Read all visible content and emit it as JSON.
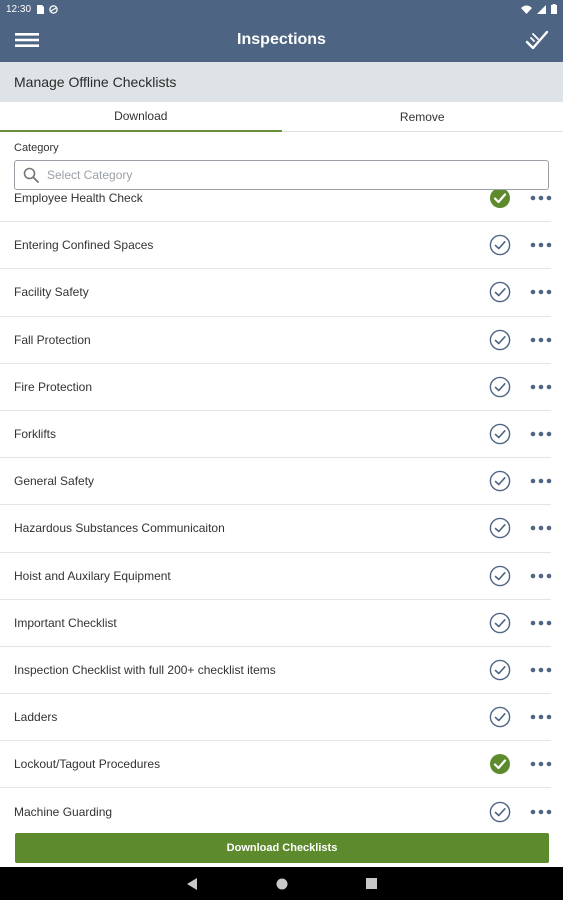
{
  "status_bar": {
    "time": "12:30"
  },
  "app_bar": {
    "title": "Inspections"
  },
  "subheader": {
    "title": "Manage Offline Checklists"
  },
  "tabs": [
    {
      "label": "Download",
      "active": true
    },
    {
      "label": "Remove",
      "active": false
    }
  ],
  "category": {
    "label": "Category",
    "placeholder": "Select Category"
  },
  "checklists": [
    {
      "label": "Employee Health Check",
      "status": "downloaded"
    },
    {
      "label": "Entering Confined Spaces",
      "status": "available"
    },
    {
      "label": "Facility Safety",
      "status": "available"
    },
    {
      "label": "Fall Protection",
      "status": "available"
    },
    {
      "label": "Fire Protection",
      "status": "available"
    },
    {
      "label": "Forklifts",
      "status": "available"
    },
    {
      "label": "General Safety",
      "status": "available"
    },
    {
      "label": "Hazardous Substances Communicaiton",
      "status": "available"
    },
    {
      "label": "Hoist and Auxilary Equipment",
      "status": "available"
    },
    {
      "label": "Important Checklist",
      "status": "available"
    },
    {
      "label": "Inspection Checklist with full 200+ checklist items",
      "status": "available"
    },
    {
      "label": "Ladders",
      "status": "available"
    },
    {
      "label": "Lockout/Tagout Procedures",
      "status": "downloaded"
    },
    {
      "label": "Machine Guarding",
      "status": "available"
    }
  ],
  "footer": {
    "download_label": "Download Checklists"
  },
  "colors": {
    "primary": "#4d6482",
    "accent": "#5e8a2e",
    "downloaded": "#5e8a2e",
    "available": "#4d6482"
  },
  "icons": {
    "menu": "hamburger-icon",
    "app_action": "checklist-check-icon",
    "search": "search-icon",
    "downloaded": "filled-check-circle-icon",
    "available": "outline-check-circle-icon",
    "more": "more-dots-icon"
  }
}
